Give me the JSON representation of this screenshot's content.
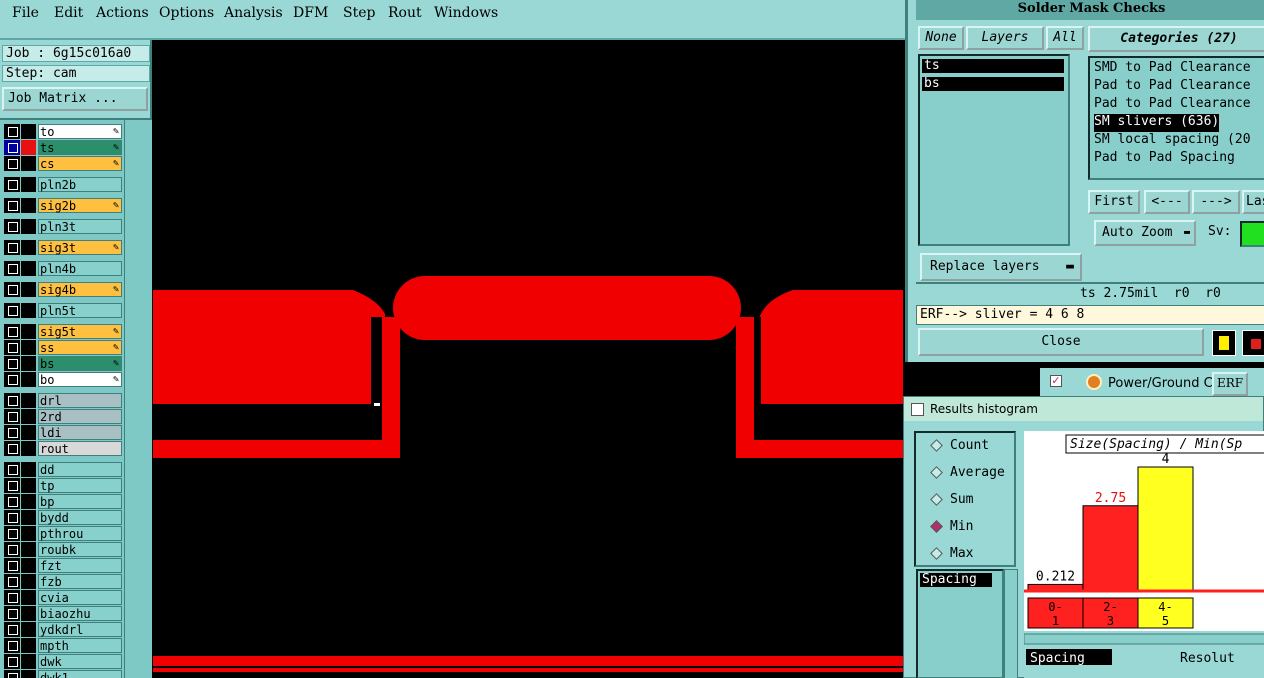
{
  "menu": [
    "File",
    "Edit",
    "Actions",
    "Options",
    "Analysis",
    "DFM",
    "Step",
    "Rout",
    "Windows"
  ],
  "job": {
    "job_line": "Job : 6g15c016a0",
    "step_line": "Step: cam",
    "matrix_button": "Job Matrix ..."
  },
  "layers": [
    {
      "name": "to",
      "color": "#ffffff",
      "box": "#000000",
      "gap": false
    },
    {
      "name": "ts",
      "color": "#2a8f6a",
      "box": "#e81010",
      "gap": false,
      "active": true
    },
    {
      "name": "cs",
      "color": "#ffc040",
      "box": "#000000",
      "gap": false
    },
    {
      "name": "pln2b",
      "color": "#88d0cb",
      "box": "#000000",
      "gap": true
    },
    {
      "name": "sig2b",
      "color": "#ffc040",
      "box": "#000000",
      "gap": true
    },
    {
      "name": "pln3t",
      "color": "#88d0cb",
      "box": "#000000",
      "gap": true
    },
    {
      "name": "sig3t",
      "color": "#ffc040",
      "box": "#000000",
      "gap": true
    },
    {
      "name": "pln4b",
      "color": "#88d0cb",
      "box": "#000000",
      "gap": true
    },
    {
      "name": "sig4b",
      "color": "#ffc040",
      "box": "#000000",
      "gap": true
    },
    {
      "name": "pln5t",
      "color": "#88d0cb",
      "box": "#000000",
      "gap": true
    },
    {
      "name": "sig5t",
      "color": "#ffc040",
      "box": "#000000",
      "gap": true
    },
    {
      "name": "ss",
      "color": "#ffc040",
      "box": "#000000",
      "gap": false
    },
    {
      "name": "bs",
      "color": "#2a8f6a",
      "box": "#000000",
      "gap": false
    },
    {
      "name": "bo",
      "color": "#ffffff",
      "box": "#000000",
      "gap": false
    },
    {
      "name": "drl",
      "color": "#a8c0c4",
      "box": "#000000",
      "gap": true
    },
    {
      "name": "2rd",
      "color": "#a8c0c4",
      "box": "#000000",
      "gap": false
    },
    {
      "name": "ldi",
      "color": "#a8c0c4",
      "box": "#000000",
      "gap": false
    },
    {
      "name": "rout",
      "color": "#d8d8d8",
      "box": "#000000",
      "gap": false
    },
    {
      "name": "dd",
      "color": "#88d0cb",
      "box": "#000000",
      "gap": true
    },
    {
      "name": "tp",
      "color": "#88d0cb",
      "box": "#000000",
      "gap": false
    },
    {
      "name": "bp",
      "color": "#88d0cb",
      "box": "#000000",
      "gap": false
    },
    {
      "name": "bydd",
      "color": "#88d0cb",
      "box": "#000000",
      "gap": false
    },
    {
      "name": "pthrou",
      "color": "#88d0cb",
      "box": "#000000",
      "gap": false
    },
    {
      "name": "roubk",
      "color": "#88d0cb",
      "box": "#000000",
      "gap": false
    },
    {
      "name": "fzt",
      "color": "#88d0cb",
      "box": "#000000",
      "gap": false
    },
    {
      "name": "fzb",
      "color": "#88d0cb",
      "box": "#000000",
      "gap": false
    },
    {
      "name": "cvia",
      "color": "#88d0cb",
      "box": "#000000",
      "gap": false
    },
    {
      "name": "biaozhu",
      "color": "#88d0cb",
      "box": "#000000",
      "gap": false
    },
    {
      "name": "ydkdrl",
      "color": "#88d0cb",
      "box": "#000000",
      "gap": false
    },
    {
      "name": "mpth",
      "color": "#88d0cb",
      "box": "#000000",
      "gap": false
    },
    {
      "name": "dwk",
      "color": "#88d0cb",
      "box": "#000000",
      "gap": false
    },
    {
      "name": "dwk1",
      "color": "#88d0cb",
      "box": "#000000",
      "gap": false
    }
  ],
  "smc": {
    "title": "Solder Mask Checks",
    "none_btn": "None",
    "layers_btn": "Layers",
    "all_btn": "All",
    "layer_items": [
      "ts",
      "bs"
    ],
    "categories_title": "Categories (27)",
    "categories": [
      "SMD to Pad Clearance",
      "Pad to Pad Clearance",
      "Pad to Pad Clearance",
      "SM slivers (636)",
      "SM local spacing (20",
      "Pad to Pad Spacing"
    ],
    "selected_category": 3,
    "first_btn": "First",
    "prev_btn": "<---",
    "next_btn": "--->",
    "last_btn": "Las",
    "autozoom_btn": "Auto Zoom",
    "sv_label": "Sv:",
    "replace_btn": "Replace layers",
    "status_line": "ts 2.75mil  r0  r0",
    "erf_line": "ERF--> sliver = 4 6 8",
    "close_btn": "Close"
  },
  "strip": {
    "label": "Power/Ground C",
    "erf": "ERF"
  },
  "hist": {
    "title": "Results histogram",
    "modes": [
      "Count",
      "Average",
      "Sum",
      "Min",
      "Max"
    ],
    "selected_mode": "Min",
    "spacing_list_item": "Spacing",
    "spacing_footer": "Spacing",
    "resolution": "Resolut",
    "colors": {
      "red": "#ff2020",
      "yellow": "#ffff20"
    }
  },
  "chart_data": {
    "type": "bar",
    "title": "Size(Spacing) / Min(Sp",
    "categories": [
      "0-1",
      "2-3",
      "4-5"
    ],
    "values": [
      0.212,
      2.75,
      4
    ],
    "value_labels": [
      "0.212",
      "2.75",
      "4"
    ],
    "bar_colors": [
      "#ff2020",
      "#ff2020",
      "#ffff20"
    ],
    "ylim": [
      0,
      4.4
    ]
  }
}
